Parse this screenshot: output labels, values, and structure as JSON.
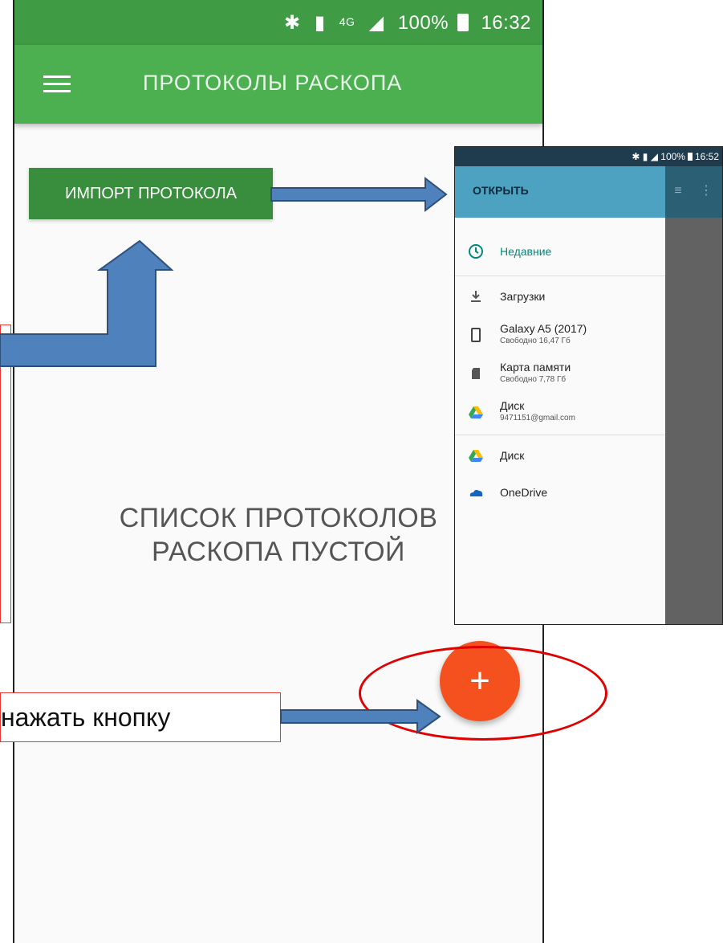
{
  "status_bar": {
    "icons": [
      "bluetooth-icon",
      "sim-icon",
      "4g-icon",
      "signal-icon"
    ],
    "battery": "100%",
    "time": "16:32"
  },
  "app_bar": {
    "title": "ПРОТОКОЛЫ РАСКОПА"
  },
  "import_button": {
    "label": "ИМПОРТ ПРОТОКОЛА"
  },
  "empty_state": {
    "line1": "СПИСОК ПРОТОКОЛОВ",
    "line2": "РАСКОПА ПУСТОЙ"
  },
  "fab": {
    "label": "+"
  },
  "callout": {
    "press_text": "нажать кнопку"
  },
  "inset": {
    "status": {
      "battery": "100%",
      "time": "16:52"
    },
    "drawer_title": "ОТКРЫТЬ",
    "items": [
      {
        "label": "Недавние",
        "sub": "",
        "icon": "clock-icon"
      },
      {
        "label": "Загрузки",
        "sub": "",
        "icon": "download-icon"
      },
      {
        "label": "Galaxy A5 (2017)",
        "sub": "Свободно 16,47 Гб",
        "icon": "phone-icon"
      },
      {
        "label": "Карта памяти",
        "sub": "Свободно 7,78 Гб",
        "icon": "sd-card-icon"
      },
      {
        "label": "Диск",
        "sub": "9471151@gmail.com",
        "icon": "google-drive-icon"
      },
      {
        "label": "Диск",
        "sub": "",
        "icon": "google-drive-icon"
      },
      {
        "label": "OneDrive",
        "sub": "",
        "icon": "onedrive-icon"
      }
    ]
  },
  "colors": {
    "status_bar": "#3f9b44",
    "app_bar": "#4caf50",
    "import_button": "#388e3c",
    "fab": "#f4511e",
    "drawer_header": "#4ea2c1",
    "accent_teal": "#00897b",
    "arrow_fill": "#4f81bd",
    "highlight": "#e00000"
  }
}
